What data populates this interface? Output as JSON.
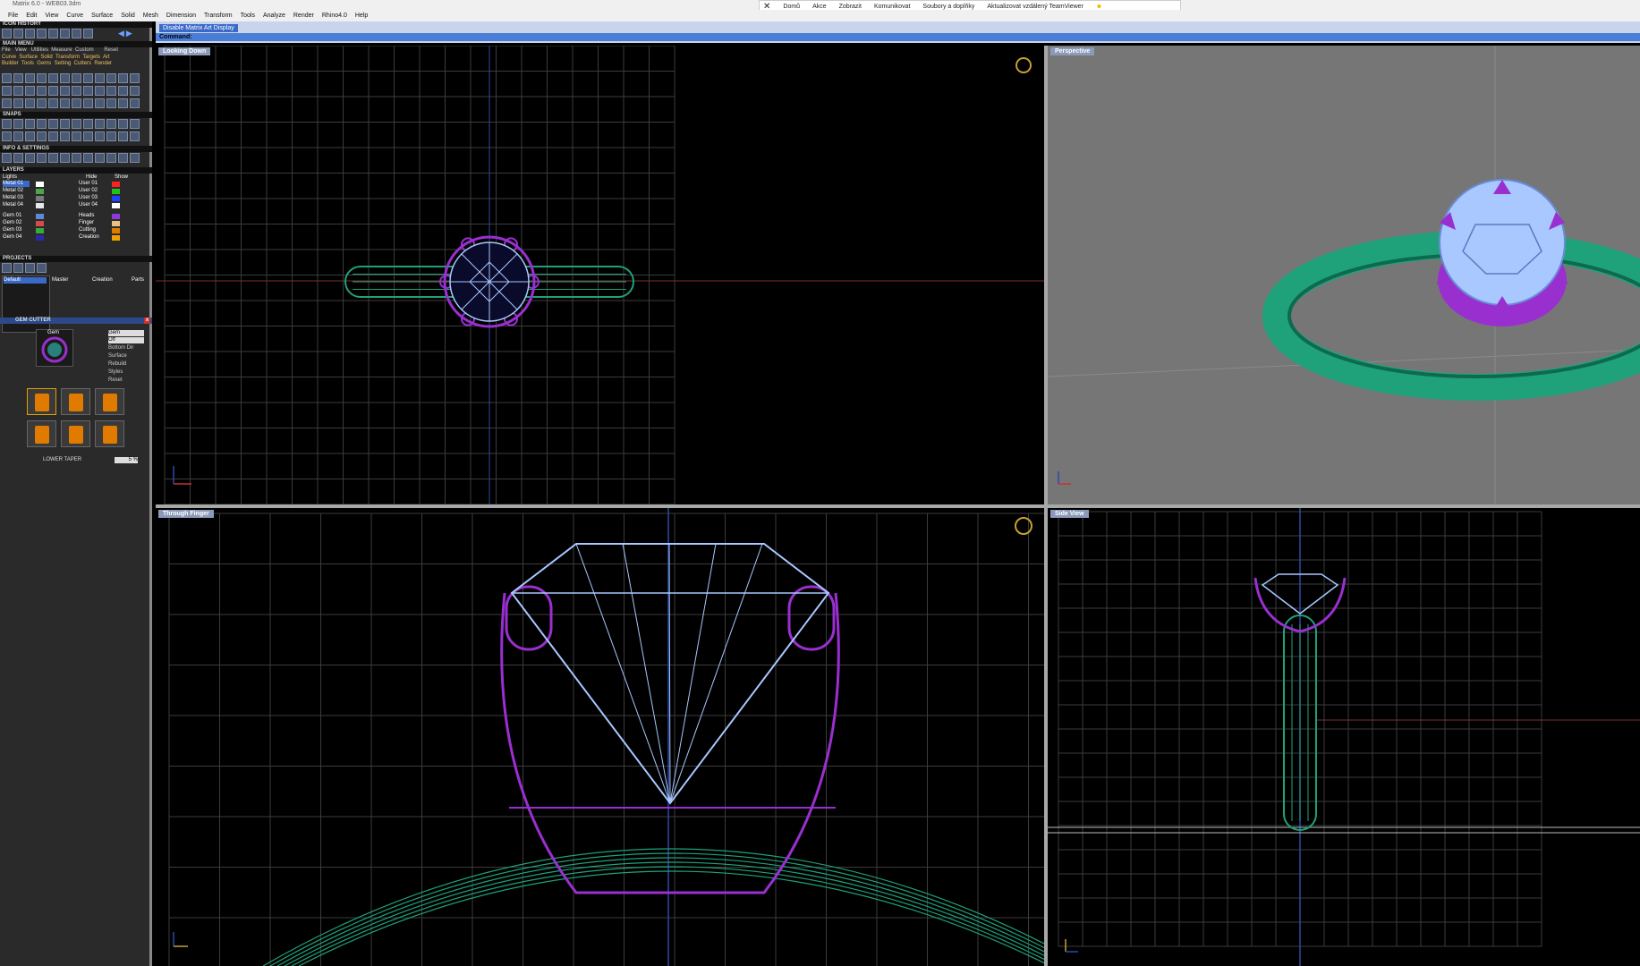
{
  "window": {
    "title": "Matrix 6.0 - WEB03.3dm"
  },
  "menu": [
    "File",
    "Edit",
    "View",
    "Curve",
    "Surface",
    "Solid",
    "Mesh",
    "Dimension",
    "Transform",
    "Tools",
    "Analyze",
    "Render",
    "Rhino4.0",
    "Help"
  ],
  "teamviewer": {
    "items": [
      "Domů",
      "Akce",
      "Zobrazit",
      "Komunikovat",
      "Soubory a doplňky",
      "Aktualizovat vzdálený TeamViewer"
    ]
  },
  "command": {
    "toggle_label": "Disable Matrix Art Display",
    "prompt": "Command:"
  },
  "left_panel": {
    "icon_history": "ICON HISTORY",
    "main_menu": "MAIN MENU",
    "main_menu_tabs": [
      "File",
      "View",
      "Utilities",
      "Measure",
      "Custom",
      "Reset"
    ],
    "categories_row1": [
      "Curve",
      "Surface",
      "Solid",
      "Transform",
      "Targets",
      "Art"
    ],
    "categories_row2": [
      "Builder",
      "Tools",
      "Gems",
      "Setting",
      "Cutters",
      "Render"
    ],
    "snaps": "SNAPS",
    "info_settings": "INFO & SETTINGS",
    "layers_title": "LAYERS",
    "layers_header": {
      "lights": "Lights",
      "hide": "Hide",
      "show": "Show"
    },
    "layers_left": [
      "Metal 01",
      "Metal 02",
      "Metal 03",
      "Metal 04",
      "Gem 01",
      "Gem 02",
      "Gem 03",
      "Gem 04"
    ],
    "layers_right": [
      "User 01",
      "User 02",
      "User 03",
      "User 04",
      "Heads",
      "Finger",
      "Cutting",
      "Creation"
    ],
    "layer_colors": [
      "#ffffff",
      "#4aa84a",
      "#7a7a7a",
      "#e8e8e8",
      "#5a8ad8",
      "#d84a4a",
      "#3aa83a",
      "#2a2aa8",
      "#ff2020",
      "#20c020",
      "#2040ff",
      "#ffffff",
      "#8a3ad8",
      "#e8c080",
      "#e07b00",
      "#f0a000"
    ],
    "projects_title": "PROJECTS",
    "projects": [
      "Default"
    ],
    "projects_cols": [
      "Master",
      "Creation",
      "Parts"
    ],
    "gem_cutter_title": "GEM CUTTER",
    "gem_cutter_preview_label": "Gem",
    "gem_cutter_fields": [
      "Gem",
      "Off",
      "Bottom Dir",
      "Surface",
      "Rebuild",
      "Styles",
      "Reset"
    ],
    "lower_taper_label": "LOWER TAPER",
    "lower_taper_value": "5 %"
  },
  "viewports": {
    "top_left": {
      "label": "Looking Down"
    },
    "top_right": {
      "label": "Perspective"
    },
    "bottom_left": {
      "label": "Through Finger"
    },
    "bottom_right": {
      "label": "Side View"
    }
  },
  "colors": {
    "ring_green": "#1fa27a",
    "head_purple": "#9a2fd0",
    "gem_blue": "#a8c8ff",
    "grid": "#3c3c3c",
    "perspective_bg": "#767676"
  }
}
